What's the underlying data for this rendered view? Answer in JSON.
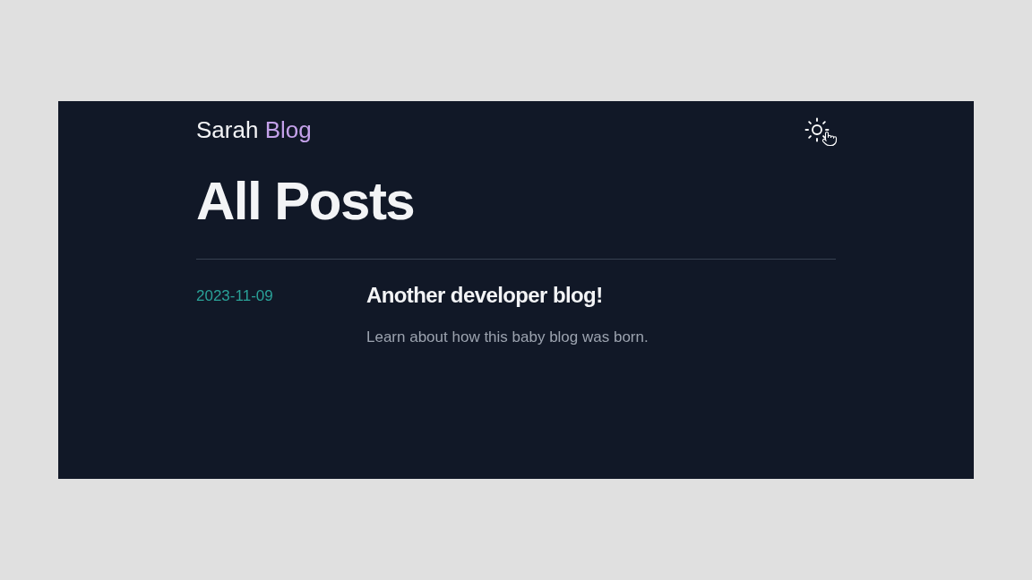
{
  "header": {
    "brand": [
      "Sarah",
      "Blog"
    ]
  },
  "heading": "All Posts",
  "posts": [
    {
      "date": "2023-11-09",
      "title": "Another developer blog!",
      "summary": "Learn about how this baby blog was born."
    }
  ]
}
